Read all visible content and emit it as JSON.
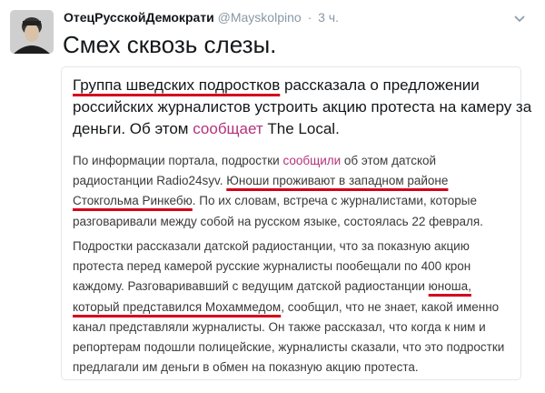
{
  "tweet": {
    "author_name": "ОтецРусскойДемократи",
    "handle": "@Mayskolpino",
    "separator": "·",
    "time": "3 ч.",
    "text": "Смех сквозь слезы."
  },
  "card": {
    "lead": {
      "l1_underlined": "Группа шведских подростков",
      "l1_rest": " рассказала о предложении",
      "l2": "российских журналистов устроить акцию протеста на камеру за",
      "l3_pre": "деньги. Об этом ",
      "l3_link": "сообщает",
      "l3_post": " The Local."
    },
    "p1": {
      "l1_pre": "По информации портала, подростки ",
      "l1_link": "сообщили",
      "l1_post": " об этом датской",
      "l2_pre": "радиостанции Radio24syv. ",
      "l2_underlined": "Юноши проживают в западном районе",
      "l3_underlined": "Стокгольма Ринкебю",
      "l3_post": ". По их словам, встреча с журналистами, которые",
      "l4": "разговаривали между собой на русском языке, состоялась 22 февраля."
    },
    "p2": {
      "l1": "Подростки рассказали датской радиостанции, что за показную акцию",
      "l2": "протеста перед камерой русские журналисты пообещали по 400 крон",
      "l3_pre": "каждому. Разговаривавший с ведущим датской радиостанции ",
      "l3_underlined": "юноша,",
      "l4_underlined": "который представился Мохаммедом",
      "l4_post": ", сообщил, что не знает, какой именно",
      "l5": "канал представляли журналисты. Он также рассказал, что когда к ним и",
      "l6": "репортерам подошли полицейские, журналисты сказали, что это подростки",
      "l7": "предлагали им деньги в обмен на показную акцию протеста."
    }
  },
  "colors": {
    "link": "#b3337a",
    "underline": "#d5001c",
    "muted": "#8899a6"
  },
  "icons": {
    "avatar": "avatar-portrait",
    "menu": "chevron-down-icon"
  }
}
